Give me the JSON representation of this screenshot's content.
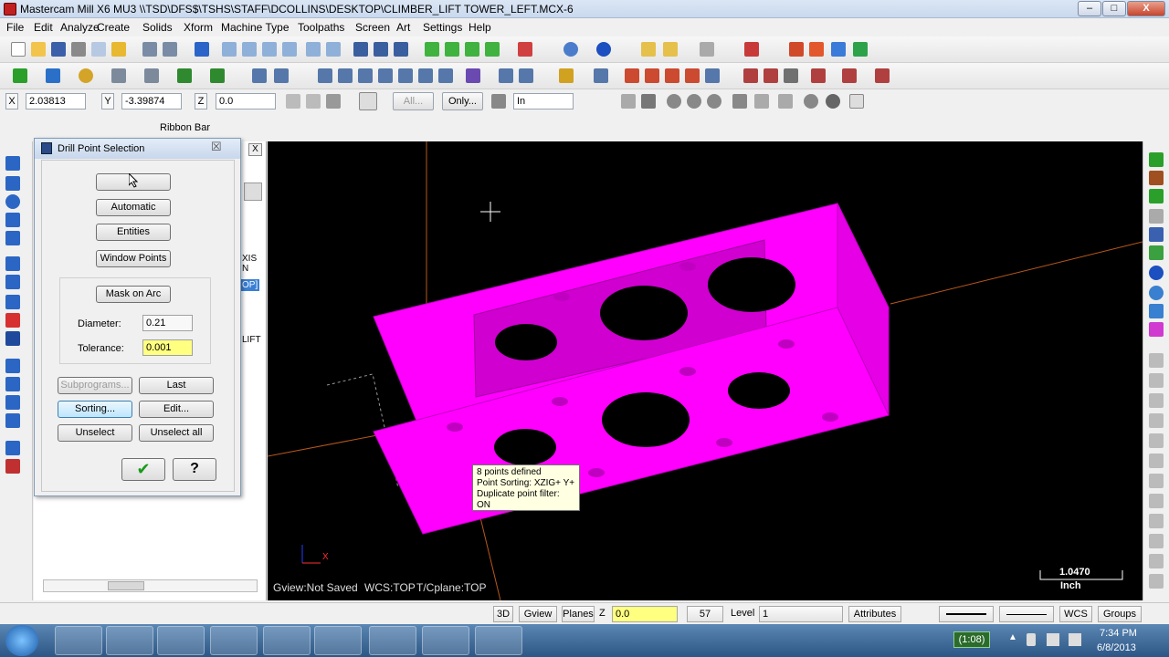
{
  "window": {
    "title": "Mastercam Mill X6 MU3  \\\\TSD\\DFS$\\TSHS\\STAFF\\DCOLLINS\\DESKTOP\\CLIMBER_LIFT TOWER_LEFT.MCX-6",
    "minimize": "–",
    "maximize": "□",
    "close": "X"
  },
  "menu": [
    "File",
    "Edit",
    "Analyze",
    "Create",
    "Solids",
    "Xform",
    "Machine Type",
    "Screen",
    "Art",
    "Settings",
    "Help",
    "Toolpaths"
  ],
  "ribbon": {
    "x_label": "X",
    "x_value": "2.03813",
    "y_label": "Y",
    "y_value": "-3.39874",
    "z_label": "Z",
    "z_value": "0.0",
    "all_btn": "All...",
    "only_btn": "Only...",
    "in_value": "In",
    "ribbon_bar_caption": "Ribbon Bar"
  },
  "dialog": {
    "title": "Drill Point Selection",
    "close": "☒",
    "btn_blank": "",
    "btn_automatic": "Automatic",
    "btn_entities": "Entities",
    "btn_window_points": "Window Points",
    "btn_mask_on_arc": "Mask on Arc",
    "diameter_label": "Diameter:",
    "diameter_value": "0.21",
    "tolerance_label": "Tolerance:",
    "tolerance_value": "0.001",
    "btn_subprograms": "Subprograms...",
    "btn_last": "Last",
    "btn_sorting": "Sorting...",
    "btn_edit": "Edit...",
    "btn_unselect": "Unselect",
    "btn_unselect_all": "Unselect all",
    "ok_glyph": "✔",
    "help_glyph": "?"
  },
  "leftpanel": {
    "partial1": "XIS N",
    "partial2": "OP]",
    "partial3": "LIFT",
    "close": "X"
  },
  "viewport": {
    "gview": "Gview:Not Saved",
    "wcs": "WCS:TOP",
    "tcplane": "T/Cplane:TOP",
    "scale_value": "1.0470",
    "scale_unit": "Inch",
    "axis_x": "X",
    "tooltip_line1": "8 points defined",
    "tooltip_line2": "Point Sorting: XZIG+ Y+",
    "tooltip_line3": "Duplicate point filter: ON"
  },
  "statusbar": {
    "btn_3d": "3D",
    "btn_gview": "Gview",
    "btn_planes": "Planes",
    "z_label": "Z",
    "z_value": "0.0",
    "color_value": "57",
    "level_label": "Level",
    "level_value": "1",
    "attributes": "Attributes",
    "wcs": "WCS",
    "groups": "Groups"
  },
  "taskbar": {
    "timer": "1:08",
    "time": "7:34 PM",
    "date": "6/8/2013"
  },
  "colors": {
    "part_magenta": "#ff00ff",
    "viewport_bg": "#000000",
    "axis_orange": "#b8581a",
    "tolerance_bg": "#ffff80",
    "z_field_bg": "#ffff80"
  }
}
